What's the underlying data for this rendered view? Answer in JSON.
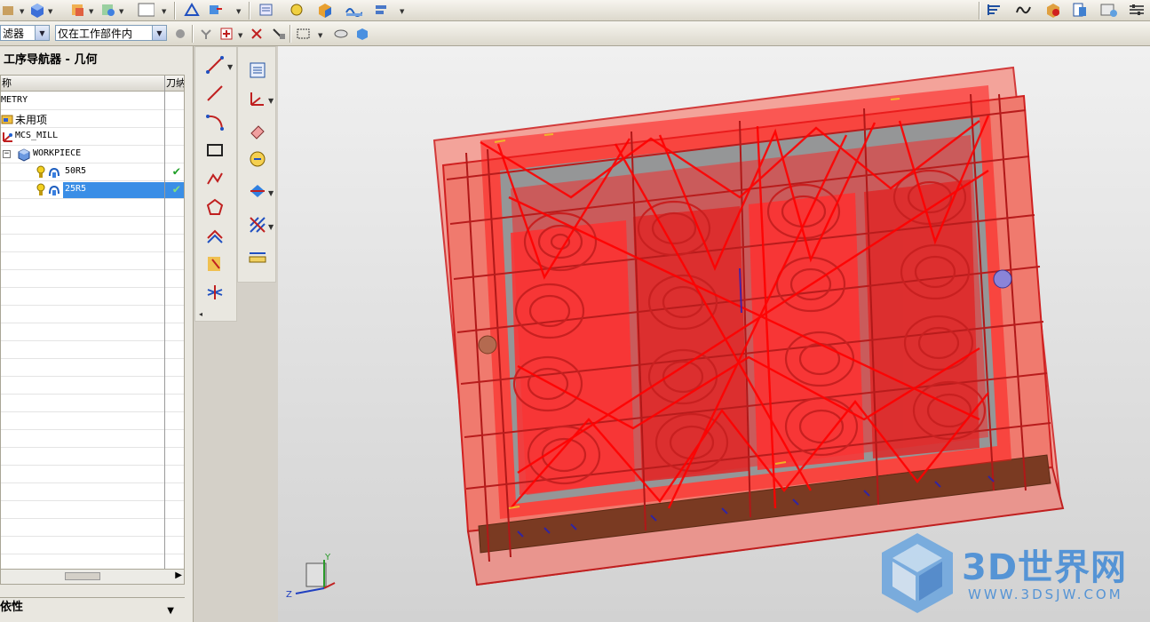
{
  "toolbar": {
    "filter_label": "滤器",
    "scope_value": "仅在工作部件内"
  },
  "navigator": {
    "title": "工序导航器 - 几何",
    "columns": {
      "name": "称",
      "tool": "刀纳"
    },
    "rows": [
      {
        "label": "METRY",
        "icon": "geometry-root-icon",
        "status": ""
      },
      {
        "label": "未用项",
        "icon": "unused-folder-icon",
        "status": ""
      },
      {
        "label": "MCS_MILL",
        "icon": "mcs-icon",
        "status": ""
      },
      {
        "label": "WORKPIECE",
        "icon": "workpiece-icon",
        "status": ""
      },
      {
        "label": "50R5",
        "icon": "operation-icon",
        "status": "check"
      },
      {
        "label": "25R5",
        "icon": "operation-icon",
        "status": "check",
        "selected": true
      }
    ],
    "dependency_label": "依性"
  },
  "viewport": {
    "axis_z": "Z",
    "axis_y": "Y",
    "watermark_text": "3D世界网",
    "watermark_url": "WWW.3DSJW.COM"
  },
  "colors": {
    "mold_fill": "#f07a6e",
    "toolpath_red": "#ff0000",
    "selection_blue": "#3a8ee6",
    "check_green": "#22a02a",
    "watermark_blue": "#4b8fd6"
  }
}
